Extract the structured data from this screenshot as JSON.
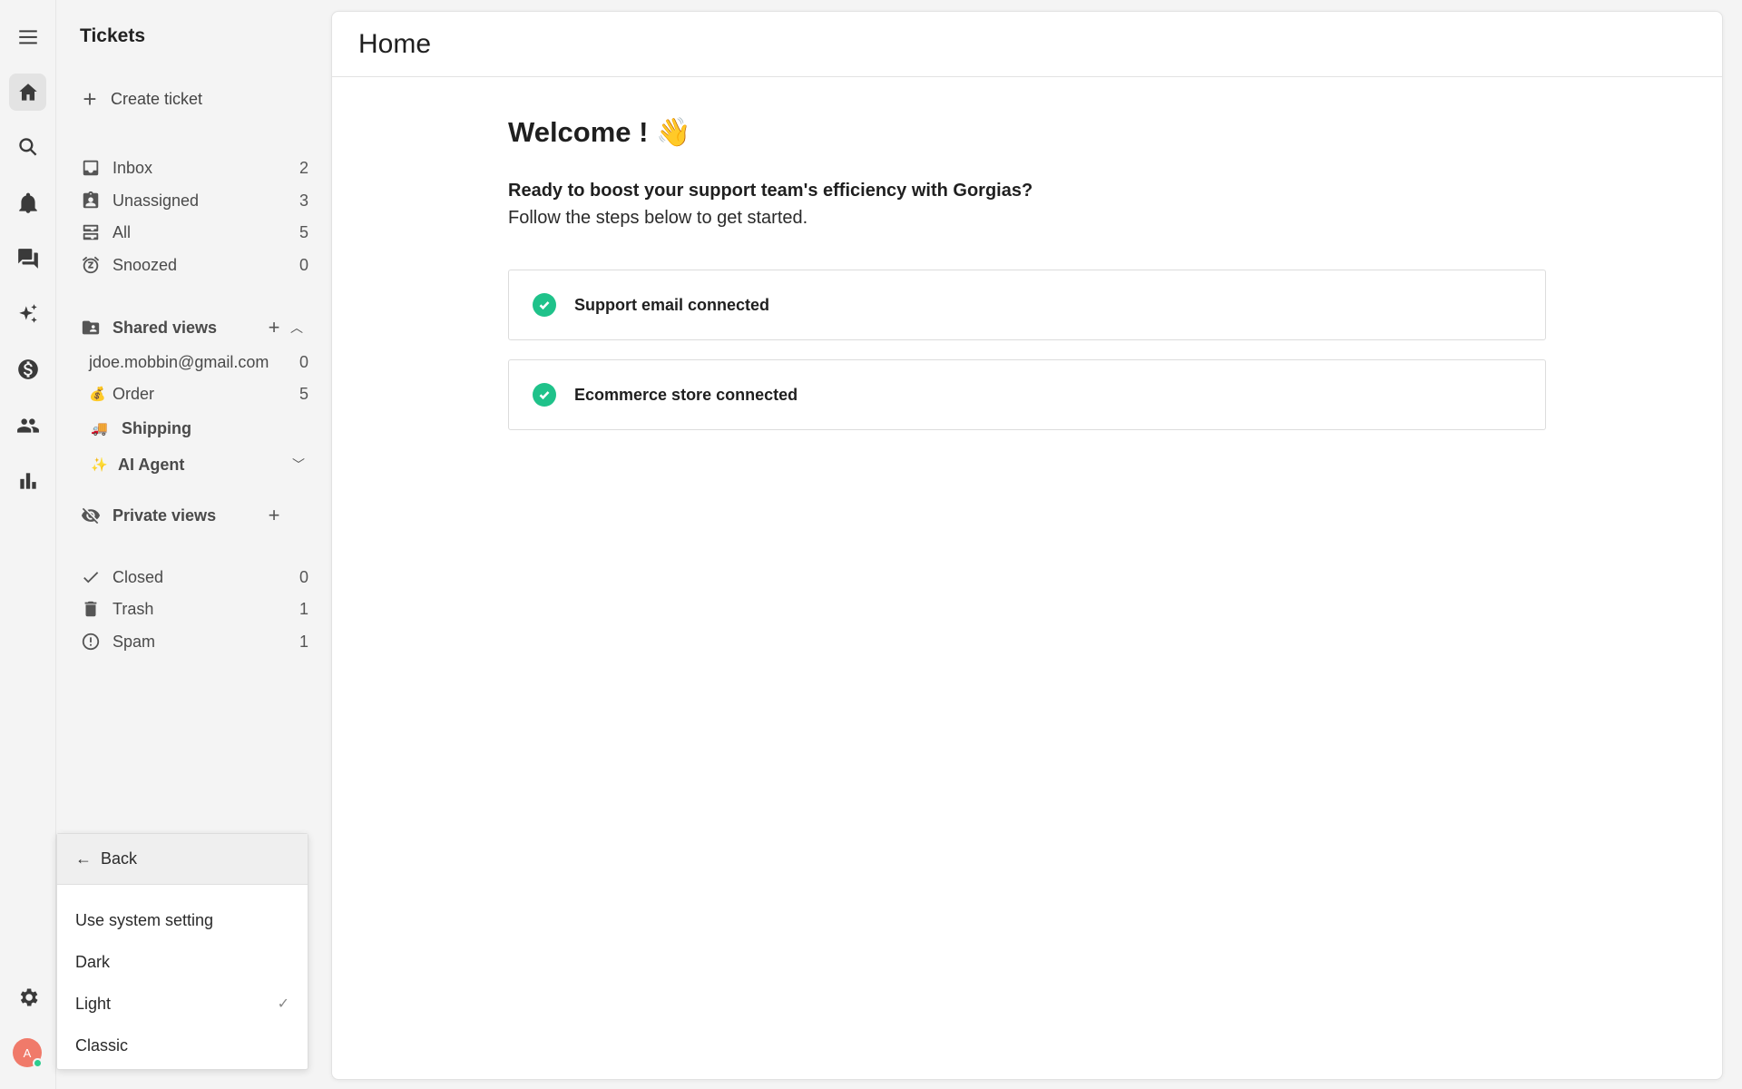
{
  "rail": {
    "items": [
      "menu-icon",
      "home-icon",
      "search-icon",
      "bell-icon",
      "chat-icon",
      "sparkle-icon",
      "dollar-icon",
      "users-icon",
      "bar-chart-icon"
    ],
    "bottom": [
      "gear-icon"
    ],
    "avatar_initial": "A"
  },
  "nav": {
    "title": "Tickets",
    "create_label": "Create ticket",
    "primary": [
      {
        "label": "Inbox",
        "count": "2",
        "icon": "inbox-icon"
      },
      {
        "label": "Unassigned",
        "count": "3",
        "icon": "badge-icon"
      },
      {
        "label": "All",
        "count": "5",
        "icon": "tray-icon"
      },
      {
        "label": "Snoozed",
        "count": "0",
        "icon": "alarm-icon"
      }
    ],
    "shared_views": {
      "label": "Shared views",
      "items": [
        {
          "emoji": "",
          "label": "jdoe.mobbin@gmail.com",
          "count": "0"
        },
        {
          "emoji": "💰",
          "label": "Order",
          "count": "5"
        },
        {
          "emoji": "🚚",
          "label": "Shipping",
          "count": ""
        },
        {
          "emoji": "✨",
          "label": "AI Agent",
          "count": ""
        }
      ]
    },
    "private_views": {
      "label": "Private views"
    },
    "secondary": [
      {
        "label": "Closed",
        "count": "0",
        "icon": "check-icon"
      },
      {
        "label": "Trash",
        "count": "1",
        "icon": "trash-icon"
      },
      {
        "label": "Spam",
        "count": "1",
        "icon": "alert-icon"
      }
    ]
  },
  "theme_menu": {
    "back_label": "Back",
    "options": [
      {
        "label": "Use system setting",
        "selected": false
      },
      {
        "label": "Dark",
        "selected": false
      },
      {
        "label": "Light",
        "selected": true
      },
      {
        "label": "Classic",
        "selected": false
      }
    ]
  },
  "main": {
    "header_title": "Home",
    "welcome": "Welcome ! 👋",
    "intro_bold": "Ready to boost your support team's efficiency with Gorgias?",
    "intro": "Follow the steps below to get started.",
    "steps": [
      {
        "label": "Support email connected",
        "done": true
      },
      {
        "label": "Ecommerce store connected",
        "done": true
      }
    ]
  },
  "colors": {
    "accent_check": "#1fc28a",
    "avatar": "#f07a6a",
    "online": "#2ecc8f"
  }
}
